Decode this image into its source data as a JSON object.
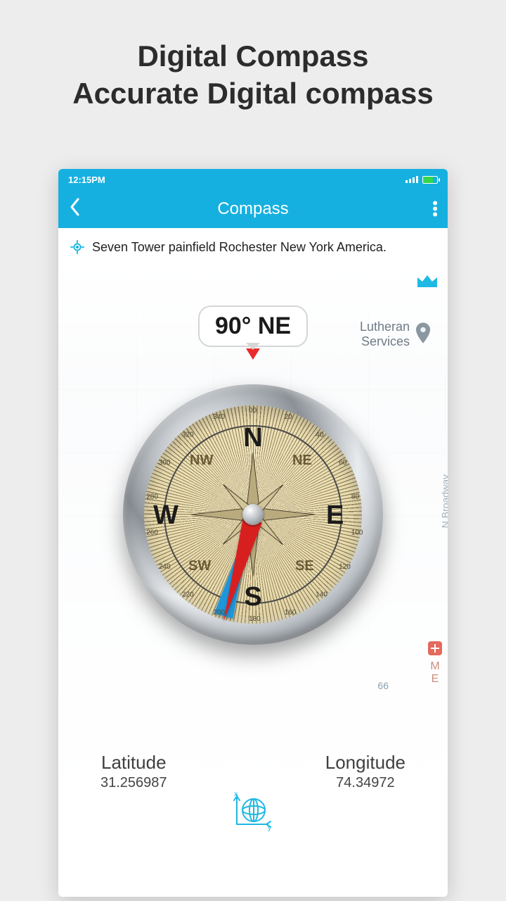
{
  "promo": {
    "line1": "Digital Compass",
    "line2": "Accurate Digital compass"
  },
  "statusbar": {
    "time": "12:15PM"
  },
  "appbar": {
    "title": "Compass"
  },
  "location": {
    "text": "Seven Tower painfield Rochester New York America."
  },
  "heading": {
    "label": "90° NE",
    "degrees": 90,
    "direction": "NE"
  },
  "compass_face": {
    "cardinals": {
      "N": "N",
      "E": "E",
      "S": "S",
      "W": "W"
    },
    "intercardinals": {
      "NE": "NE",
      "SE": "SE",
      "SW": "SW",
      "NW": "NW"
    },
    "deg_labels": [
      "00",
      "20",
      "40",
      "60",
      "80",
      "100",
      "120",
      "140",
      "160",
      "180",
      "200",
      "220",
      "240",
      "260",
      "280",
      "300",
      "320",
      "340"
    ]
  },
  "coords": {
    "lat_label": "Latitude",
    "lat_value": "31.256987",
    "lon_label": "Longitude",
    "lon_value": "74.34972"
  },
  "map_labels": {
    "poi": "Lutheran\nServices",
    "route": "66",
    "street": "N Broadway",
    "hospital": "M\nE"
  }
}
